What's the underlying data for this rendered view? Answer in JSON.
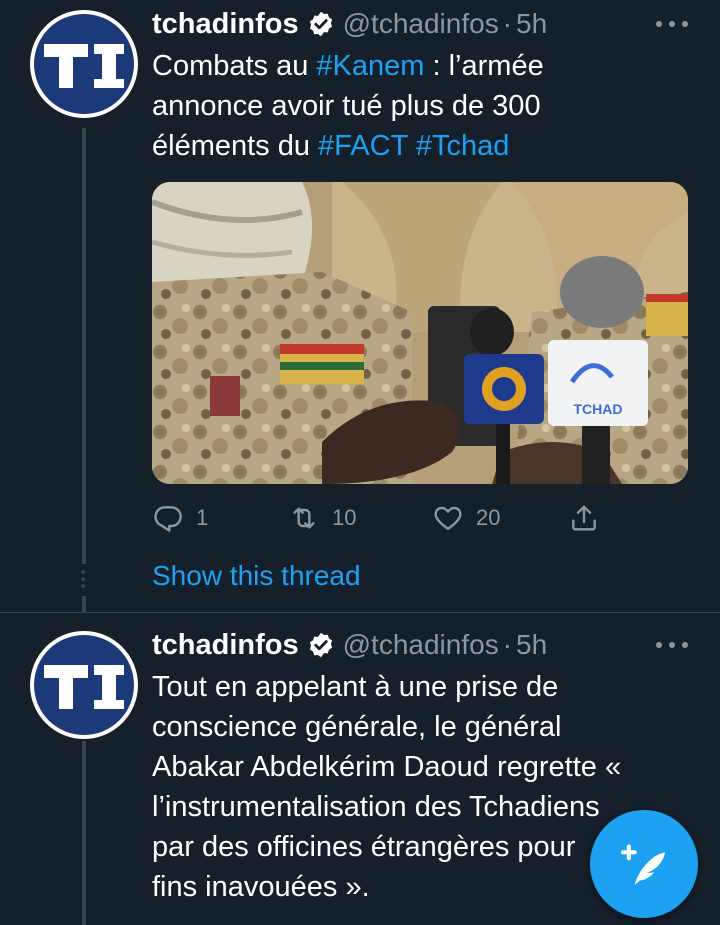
{
  "colors": {
    "background": "#15202b",
    "accent": "#1da1f2",
    "muted": "#8899a6",
    "divider": "#38444d",
    "avatar_bg": "#1d3a78"
  },
  "tweets": [
    {
      "display_name": "tchadinfos",
      "handle": "@tchadinfos",
      "separator": "·",
      "time": "5h",
      "avatar_text": "TI",
      "text_lines": [
        [
          {
            "text": "Combats au ",
            "hashtag": false
          },
          {
            "text": "#Kanem",
            "hashtag": true
          },
          {
            "text": " : l’armée",
            "hashtag": false
          }
        ],
        [
          {
            "text": "annonce avoir tué plus de 300",
            "hashtag": false
          }
        ],
        [
          {
            "text": "éléments du ",
            "hashtag": false
          },
          {
            "text": "#FACT",
            "hashtag": true
          },
          {
            "text": " ",
            "hashtag": false
          },
          {
            "text": "#Tchad",
            "hashtag": true
          }
        ]
      ],
      "media": {
        "microphone_flag_1": "Al Jazeera logo",
        "microphone_flag_2_text": "TCHAD"
      },
      "actions": {
        "reply_count": "1",
        "retweet_count": "10",
        "like_count": "20"
      },
      "show_thread": "Show this thread"
    },
    {
      "display_name": "tchadinfos",
      "handle": "@tchadinfos",
      "separator": "·",
      "time": "5h",
      "avatar_text": "TI",
      "text_lines": [
        [
          {
            "text": "Tout en appelant à une prise de",
            "hashtag": false
          }
        ],
        [
          {
            "text": "conscience générale, le général",
            "hashtag": false
          }
        ],
        [
          {
            "text": "Abakar Abdelkérim Daoud regrette «",
            "hashtag": false
          }
        ],
        [
          {
            "text": "l’instrumentalisation des Tchadiens",
            "hashtag": false
          }
        ],
        [
          {
            "text": "par des officines étrangères pour",
            "hashtag": false
          }
        ],
        [
          {
            "text": "fins inavouées ».",
            "hashtag": false
          }
        ]
      ]
    }
  ],
  "icons": {
    "verified": "verified-badge-icon",
    "more": "more-options-icon",
    "reply": "reply-icon",
    "retweet": "retweet-icon",
    "like": "heart-icon",
    "share": "share-icon",
    "compose": "compose-tweet-icon"
  }
}
